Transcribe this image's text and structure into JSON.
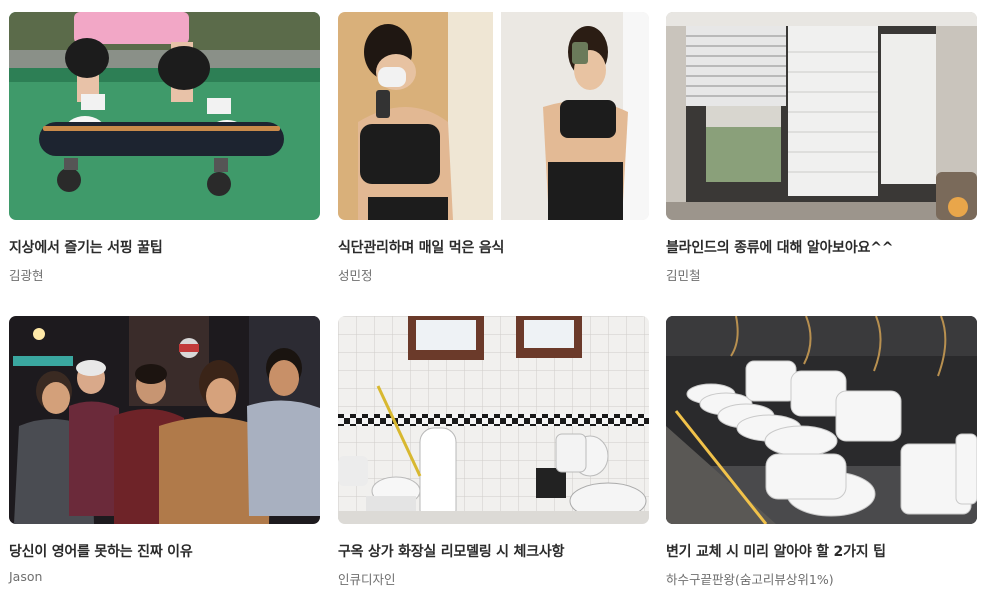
{
  "cards": [
    {
      "title": "지상에서 즐기는 서핑 꿀팁",
      "author": "김광현",
      "image": "skateboard-photo"
    },
    {
      "title": "식단관리하며 매일 먹은 음식",
      "author": "성민정",
      "image": "fitness-mirror-selfie-photo"
    },
    {
      "title": "블라인드의 종류에 대해 알아보아요^^",
      "author": "김민철",
      "image": "window-blinds-photo"
    },
    {
      "title": "당신이 영어를 못하는 진짜 이유",
      "author": "Jason",
      "image": "group-night-photo"
    },
    {
      "title": "구옥 상가 화장실 리모델링 시 체크사항",
      "author": "인큐디자인",
      "image": "old-restroom-photo"
    },
    {
      "title": "변기 교체 시 미리 알아야 할 2가지 팁",
      "author": "하수구끝판왕(숨고리뷰상위1%)",
      "image": "toilet-showroom-photo"
    }
  ]
}
